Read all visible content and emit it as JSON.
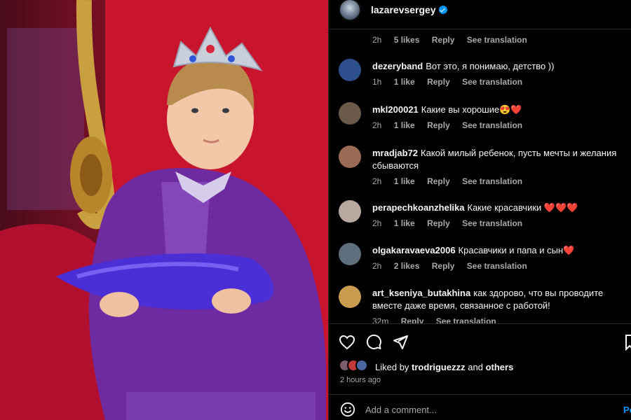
{
  "post": {
    "author": "lazarevsergey",
    "image_alt": "Boy in a crown and purple robe holding a purple pillow on a red throne"
  },
  "first_meta": {
    "time": "2h",
    "likes": "5 likes",
    "reply": "Reply",
    "translate": "See translation"
  },
  "comments": [
    {
      "user": "dezeryband",
      "text": "Вот это, я понимаю, детство ))",
      "time": "1h",
      "likes": "1 like",
      "reply": "Reply",
      "translate": "See translation",
      "avatar_color": "#2d4f8c"
    },
    {
      "user": "mkl200021",
      "text": "Какие вы хорошие😍❤️",
      "time": "2h",
      "likes": "1 like",
      "reply": "Reply",
      "translate": "See translation",
      "avatar_color": "#6b5a4a"
    },
    {
      "user": "mradjab72",
      "text": "Какой милый ребенок, пусть мечты и желания сбываются",
      "time": "2h",
      "likes": "1 like",
      "reply": "Reply",
      "translate": "See translation",
      "avatar_color": "#9a6a55"
    },
    {
      "user": "perapechkoanzhelika",
      "text": "Какие красавчики ❤️❤️❤️",
      "time": "2h",
      "likes": "1 like",
      "reply": "Reply",
      "translate": "See translation",
      "avatar_color": "#b9a8a0"
    },
    {
      "user": "olgakaravaeva2006",
      "text": "Красавчики и папа и сын❤️",
      "time": "2h",
      "likes": "2 likes",
      "reply": "Reply",
      "translate": "See translation",
      "avatar_color": "#5d6f7c"
    },
    {
      "user": "art_kseniya_butakhina",
      "text": "как здорово, что вы проводите вместе даже время, связанное с работой!",
      "time": "32m",
      "likes": "",
      "reply": "Reply",
      "translate": "See translation",
      "avatar_color": "#c89b4e"
    }
  ],
  "footer": {
    "liked_prefix": "Liked by",
    "liked_user": "trodriguezzz",
    "liked_and": "and",
    "liked_others": "others",
    "time_ago": "2 hours ago",
    "add_comment_placeholder": "Add a comment...",
    "post_label": "Post"
  },
  "colors": {
    "accent": "#0095f6",
    "muted": "#a8a8a8",
    "background": "#000000"
  },
  "icons": [
    "heart-icon",
    "comment-icon",
    "share-icon",
    "bookmark-icon",
    "emoji-icon"
  ]
}
